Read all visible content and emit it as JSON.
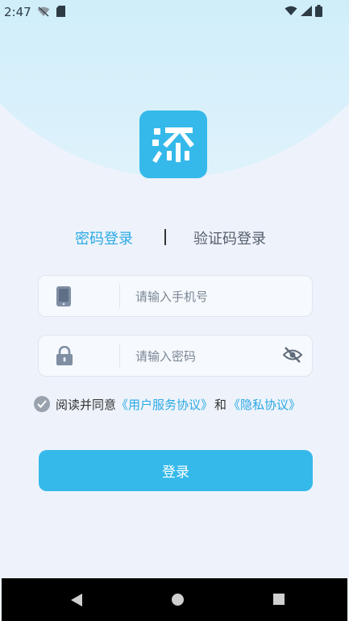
{
  "status_bar": {
    "time": "2:47"
  },
  "tabs": {
    "password_login": "密码登录",
    "code_login": "验证码登录"
  },
  "fields": {
    "phone_placeholder": "请输入手机号",
    "password_placeholder": "请输入密码"
  },
  "agreement": {
    "prefix": "阅读并同意",
    "user_agreement": "《用户服务协议》",
    "conjunction": "和",
    "privacy_agreement": "《隐私协议》"
  },
  "login_button": "登录",
  "colors": {
    "accent": "#35b9ea",
    "link": "#2aa9e4",
    "background": "#eef3fb"
  },
  "icons": [
    "app-logo-icon",
    "phone-icon",
    "lock-icon",
    "eye-off-icon",
    "check-icon",
    "back-icon",
    "home-icon",
    "recent-apps-icon"
  ]
}
